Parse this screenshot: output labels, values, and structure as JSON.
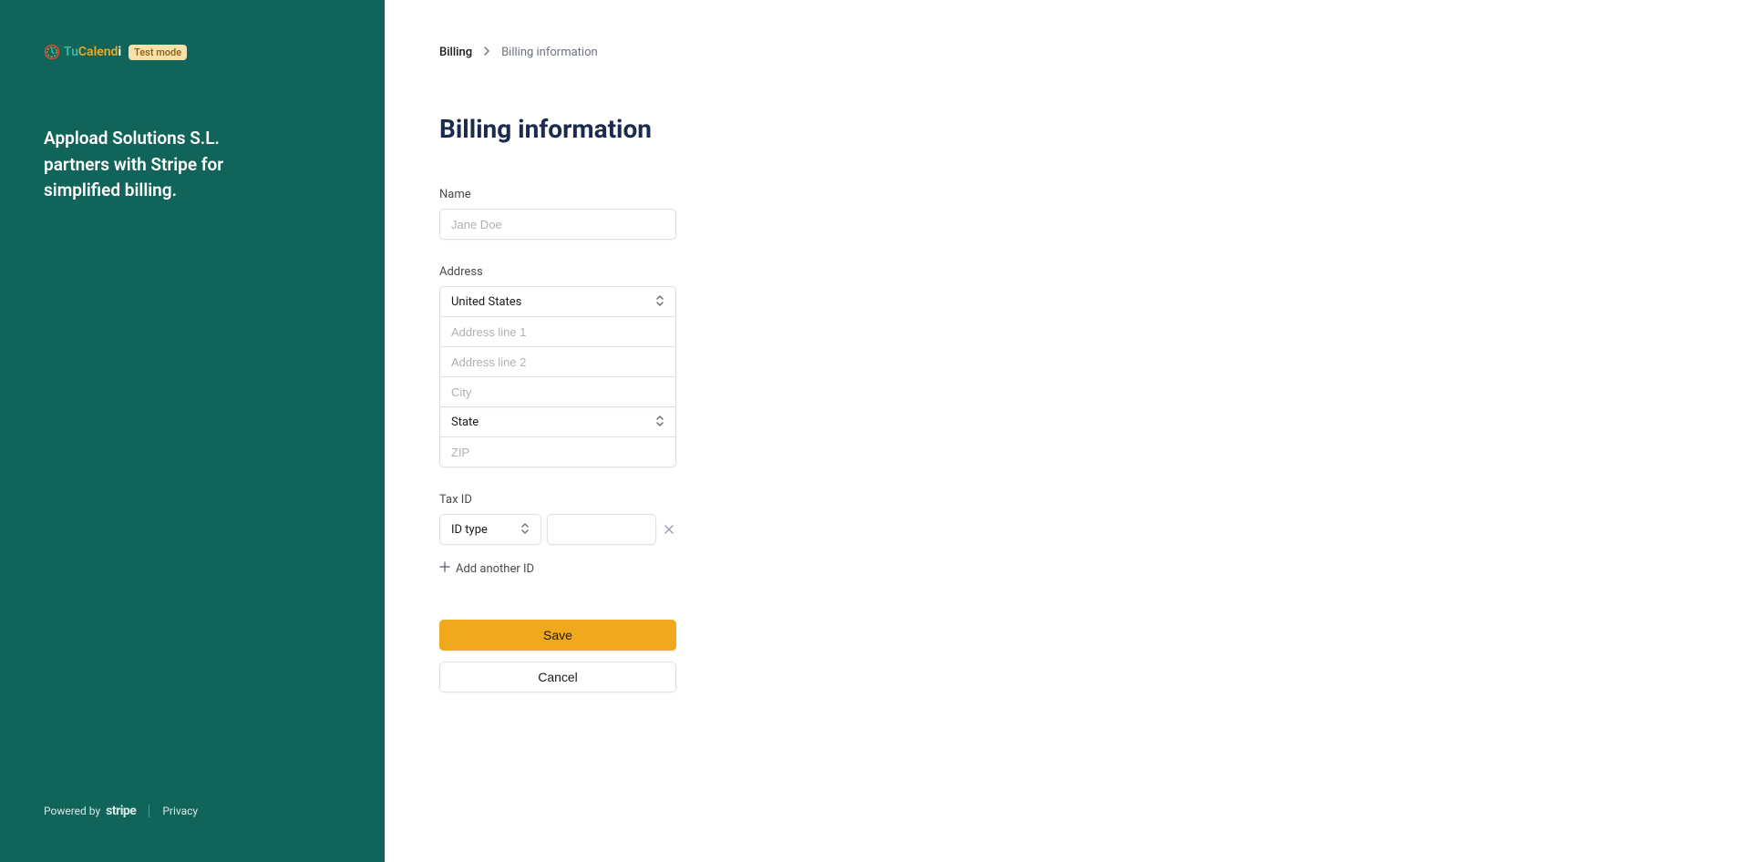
{
  "sidebar": {
    "logo": {
      "tu": "Tu",
      "calend": "Calend",
      "i": "i"
    },
    "badge": "Test mode",
    "partner_text": "Appload Solutions S.L. partners with Stripe for simplified billing.",
    "powered_by": "Powered by",
    "stripe": "stripe",
    "privacy": "Privacy"
  },
  "breadcrumb": {
    "root": "Billing",
    "current": "Billing information"
  },
  "page_title": "Billing information",
  "form": {
    "name": {
      "label": "Name",
      "placeholder": "Jane Doe"
    },
    "address": {
      "label": "Address",
      "country": "United States",
      "line1_placeholder": "Address line 1",
      "line2_placeholder": "Address line 2",
      "city_placeholder": "City",
      "state": "State",
      "zip_placeholder": "ZIP"
    },
    "tax": {
      "label": "Tax ID",
      "id_type": "ID type",
      "add_another": "Add another ID"
    },
    "save": "Save",
    "cancel": "Cancel"
  }
}
